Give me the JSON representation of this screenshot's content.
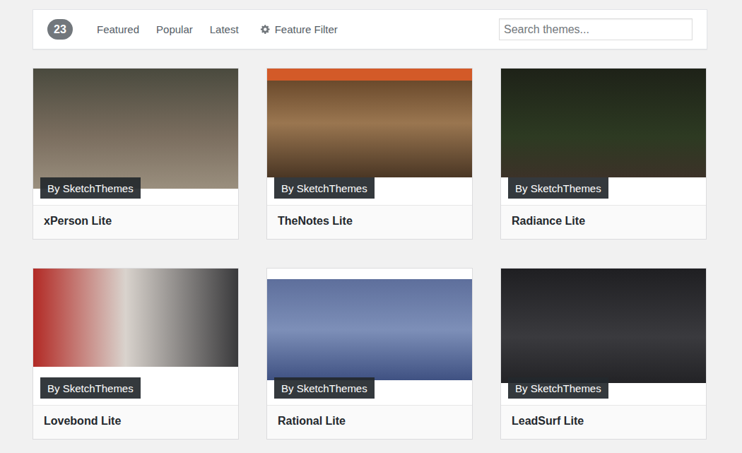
{
  "filter_bar": {
    "count": "23",
    "tabs": [
      {
        "label": "Featured",
        "selected": false
      },
      {
        "label": "Popular",
        "selected": false
      },
      {
        "label": "Latest",
        "selected": false
      }
    ],
    "feature_filter": {
      "label": "Feature Filter"
    },
    "search": {
      "placeholder": "Search themes..."
    }
  },
  "themes": [
    {
      "name": "xPerson Lite",
      "author": "By SketchThemes"
    },
    {
      "name": "TheNotes Lite",
      "author": "By SketchThemes"
    },
    {
      "name": "Radiance Lite",
      "author": "By SketchThemes"
    },
    {
      "name": "Lovebond Lite",
      "author": "By SketchThemes"
    },
    {
      "name": "Rational Lite",
      "author": "By SketchThemes"
    },
    {
      "name": "LeadSurf Lite",
      "author": "By SketchThemes"
    }
  ]
}
